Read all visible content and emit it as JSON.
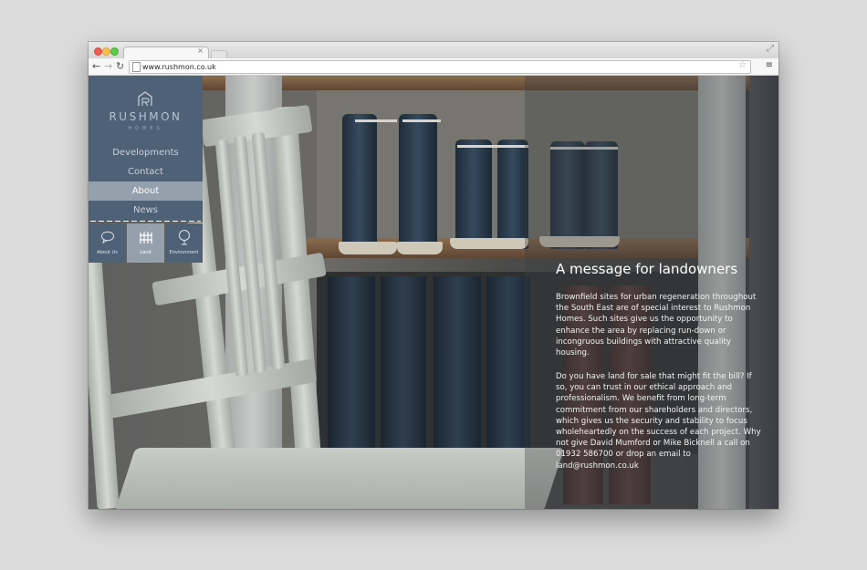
{
  "browser": {
    "url": "www.rushmon.co.uk",
    "tab_close": "×",
    "icons": {
      "back": "back-arrow-icon",
      "forward": "forward-arrow-icon",
      "reload": "reload-icon",
      "star": "bookmark-star-icon",
      "menu": "hamburger-menu-icon",
      "resize": "fullscreen-icon"
    }
  },
  "brand": {
    "name": "RUSHMON",
    "subtitle": "HOMES"
  },
  "nav": {
    "items": [
      {
        "label": "Developments"
      },
      {
        "label": "Contact"
      },
      {
        "label": "About",
        "active": true
      },
      {
        "label": "News"
      }
    ]
  },
  "subnav": {
    "items": [
      {
        "label": "About Us",
        "icon": "speech-bubble-icon"
      },
      {
        "label": "Land",
        "icon": "fence-icon",
        "active": true
      },
      {
        "label": "Environment",
        "icon": "tree-icon"
      }
    ]
  },
  "message": {
    "title": "A message for landowners",
    "paragraph1": "Brownfield sites for urban regeneration throughout the South East are of special interest to Rushmon Homes. Such sites give us the opportunity to enhance the area by replacing run-down or incongruous buildings with attractive quality housing.",
    "paragraph2": "Do you have land for sale that might fit the bill? If so, you can trust in our ethical approach and professionalism. We benefit from long-term commitment from our shareholders and directors, which gives us the security and stability to focus wholeheartedly on the success of each project. Why not give David Mumford or Mike Bicknell a call on 01932 586700 or drop an email to land@rushmon.co.uk"
  },
  "colors": {
    "sidebar": "#4e6176",
    "active_nav": "#94a0ac",
    "desktop": "#dcdcdc"
  }
}
